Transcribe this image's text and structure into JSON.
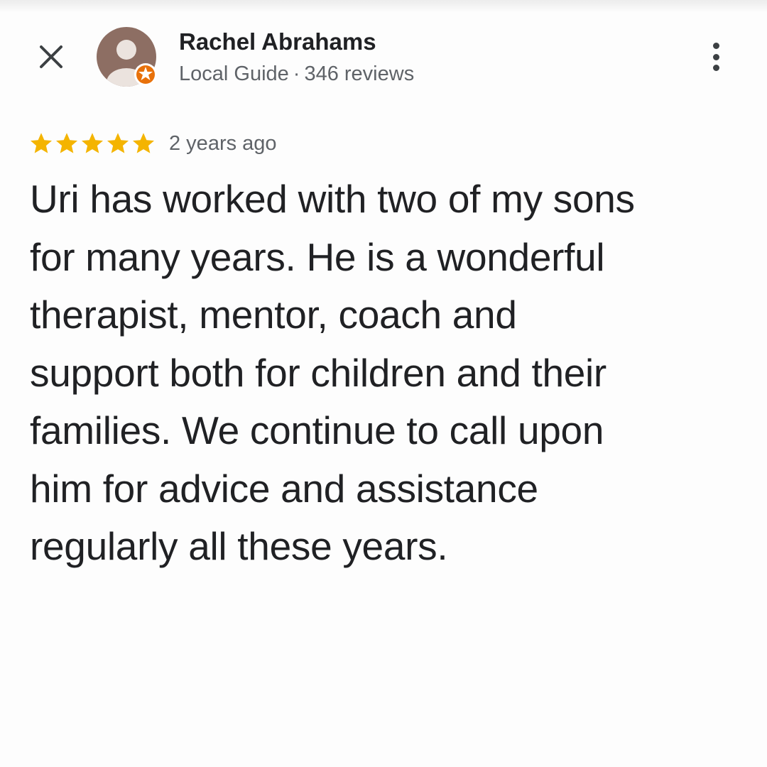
{
  "header": {
    "author_name": "Rachel Abrahams",
    "author_role": "Local Guide",
    "separator": "·",
    "review_count": "346 reviews"
  },
  "icons": {
    "close": "close-icon",
    "avatar": "avatar-person-icon",
    "badge": "local-guide-badge-icon",
    "more": "more-vertical-icon",
    "star": "star-icon"
  },
  "review": {
    "rating": 5,
    "max_rating": 5,
    "date": "2 years ago",
    "lines": [
      "Uri has worked with two of my sons",
      "for many years. He is a wonderful",
      "therapist, mentor, coach and",
      "support both for children and their",
      "families. We continue to call upon",
      "him for advice and assistance",
      "regularly all these years."
    ]
  },
  "colors": {
    "star": "#f4b400",
    "avatar_bg": "#8d6e63",
    "badge": "#e8710a",
    "text_primary": "#202124",
    "text_secondary": "#5f6368"
  }
}
